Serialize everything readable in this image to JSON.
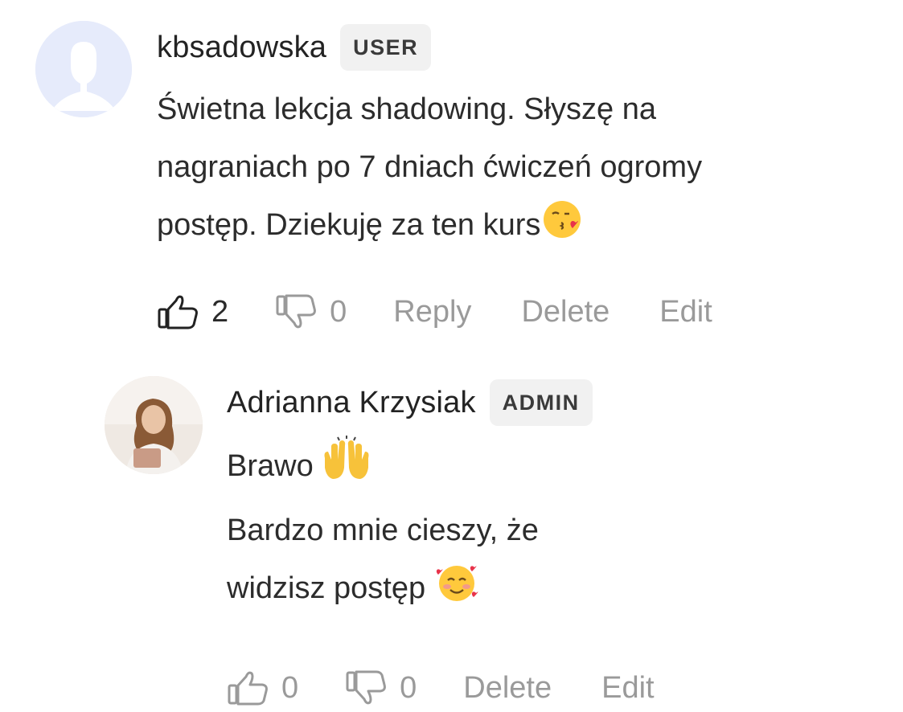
{
  "comments": [
    {
      "username": "kbsadowska",
      "role": "USER",
      "text_lines": [
        "Świetna lekcja shadowing. Słyszę na",
        "nagraniach po 7 dniach ćwiczeń ogromy",
        "postęp. Dziekuję za ten kurs"
      ],
      "emoji": "kissing-face-with-heart",
      "likes": "2",
      "dislikes": "0",
      "reply_label": "Reply",
      "delete_label": "Delete",
      "edit_label": "Edit"
    },
    {
      "username": "Adrianna Krzysiak",
      "role": "ADMIN",
      "text_lines": [
        "Brawo",
        "Bardzo mnie cieszy, że",
        "widzisz postęp"
      ],
      "emojis": [
        "raising-hands",
        "smiling-face-with-hearts"
      ],
      "likes": "0",
      "dislikes": "0",
      "delete_label": "Delete",
      "edit_label": "Edit"
    }
  ],
  "colors": {
    "text": "#2c2c2c",
    "muted": "#9a9a9a",
    "badge_bg": "#f1f1f1",
    "avatar_placeholder": "#e6ebfb"
  }
}
